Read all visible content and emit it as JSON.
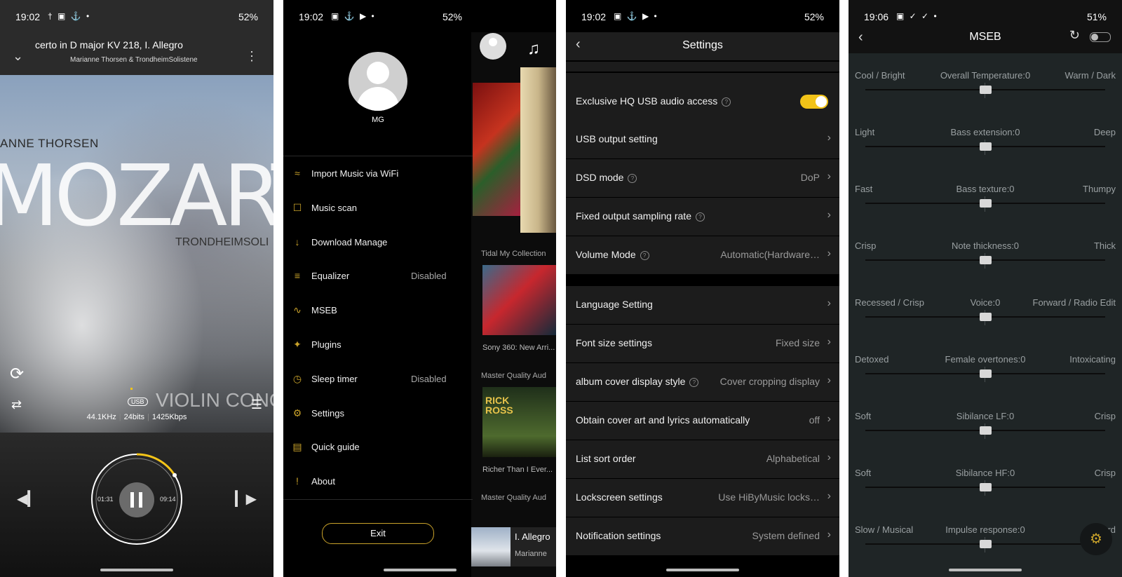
{
  "phone1": {
    "status": {
      "time": "19:02",
      "icons": "† ▣ ⚓ •",
      "right": "52%"
    },
    "track": {
      "title": "certo in D major KV 218, I. Allegro",
      "artist": "Marianne Thorsen & TrondheimSolistene"
    },
    "cover": {
      "artist": "ANNE THORSEN",
      "title": "MOZART",
      "orchestra": "TRONDHEIMSOLI",
      "subtitle": "VIOLIN CONCE"
    },
    "format": {
      "badge": "USB",
      "rate": "44.1KHz",
      "bits": "24bits",
      "bitrate": "1425Kbps"
    },
    "playback": {
      "elapsed": "01:31",
      "total": "09:14",
      "progress": 0.16
    }
  },
  "phone2": {
    "status": {
      "time": "19:02",
      "icons": "▣ ⚓ ▶ •",
      "right": "52%"
    },
    "user": {
      "name": "MG"
    },
    "menu": [
      {
        "icon": "wifi-icon",
        "glyph": "≈",
        "label": "Import Music via WiFi",
        "value": ""
      },
      {
        "icon": "music-scan-icon",
        "glyph": "☐",
        "label": "Music scan",
        "value": ""
      },
      {
        "icon": "download-icon",
        "glyph": "↓",
        "label": "Download Manage",
        "value": ""
      },
      {
        "icon": "equalizer-icon",
        "glyph": "≡",
        "label": "Equalizer",
        "value": "Disabled"
      },
      {
        "icon": "mseb-icon",
        "glyph": "∿",
        "label": "MSEB",
        "value": ""
      },
      {
        "icon": "plugins-icon",
        "glyph": "✦",
        "label": "Plugins",
        "value": ""
      },
      {
        "icon": "sleep-timer-icon",
        "glyph": "◷",
        "label": "Sleep timer",
        "value": "Disabled"
      },
      {
        "icon": "settings-icon",
        "glyph": "⚙",
        "label": "Settings",
        "value": ""
      },
      {
        "icon": "quick-guide-icon",
        "glyph": "▤",
        "label": "Quick guide",
        "value": ""
      },
      {
        "icon": "about-icon",
        "glyph": "!",
        "label": "About",
        "value": ""
      }
    ],
    "exit_label": "Exit",
    "underlay": {
      "section1": "Tidal My Collection",
      "caption1": "Sony 360: New Arri...",
      "section2": "Master Quality Aud",
      "caption2": "Richer Than I Ever...",
      "section3": "Master Quality Aud",
      "tile2_text": "RICK ROSS",
      "mini_title": "I. Allegro",
      "mini_artist": "Marianne"
    }
  },
  "phone3": {
    "status": {
      "time": "19:02",
      "icons": "▣ ⚓ ▶ •",
      "right": "52%"
    },
    "title": "Settings",
    "rows": [
      {
        "label": "Exclusive HQ USB audio access",
        "help": true,
        "value": "",
        "toggle": true
      },
      {
        "label": "USB output setting",
        "help": false,
        "value": "",
        "toggle": false
      },
      {
        "label": "DSD mode",
        "help": true,
        "value": "DoP",
        "toggle": false
      },
      {
        "label": "Fixed output sampling rate",
        "help": true,
        "value": "",
        "toggle": false
      },
      {
        "label": "Volume Mode",
        "help": true,
        "value": "Automatic(Hardware…",
        "toggle": false
      },
      {
        "label": "Language Setting",
        "help": false,
        "value": "",
        "toggle": false
      },
      {
        "label": "Font size settings",
        "help": false,
        "value": "Fixed size",
        "toggle": false
      },
      {
        "label": "album cover display style",
        "help": true,
        "value": "Cover cropping display",
        "toggle": false
      },
      {
        "label": "Obtain cover art and lyrics automatically",
        "help": false,
        "value": "off",
        "toggle": false
      },
      {
        "label": "List sort order",
        "help": false,
        "value": "Alphabetical",
        "toggle": false
      },
      {
        "label": "Lockscreen settings",
        "help": false,
        "value": "Use HiByMusic locks…",
        "toggle": false
      },
      {
        "label": "Notification settings",
        "help": false,
        "value": "System defined",
        "toggle": false
      }
    ]
  },
  "phone4": {
    "status": {
      "time": "19:06",
      "icons": "▣ ✓ ✓ •",
      "right": "51%"
    },
    "title": "MSEB",
    "sliders": [
      {
        "left": "Cool / Bright",
        "center": "Overall Temperature:0",
        "right": "Warm / Dark",
        "value": 0
      },
      {
        "left": "Light",
        "center": "Bass extension:0",
        "right": "Deep",
        "value": 0
      },
      {
        "left": "Fast",
        "center": "Bass texture:0",
        "right": "Thumpy",
        "value": 0
      },
      {
        "left": "Crisp",
        "center": "Note thickness:0",
        "right": "Thick",
        "value": 0
      },
      {
        "left": "Recessed / Crisp",
        "center": "Voice:0",
        "right": "Forward / Radio Edit",
        "value": 0
      },
      {
        "left": "Detoxed",
        "center": "Female overtones:0",
        "right": "Intoxicating",
        "value": 0
      },
      {
        "left": "Soft",
        "center": "Sibilance LF:0",
        "right": "Crisp",
        "value": 0
      },
      {
        "left": "Soft",
        "center": "Sibilance HF:0",
        "right": "Crisp",
        "value": 0
      },
      {
        "left": "Slow / Musical",
        "center": "Impulse response:0",
        "right": "Fa      rd",
        "value": 0
      }
    ]
  },
  "colors": {
    "accent": "#c9a22a",
    "toggle_on": "#f2c318"
  }
}
